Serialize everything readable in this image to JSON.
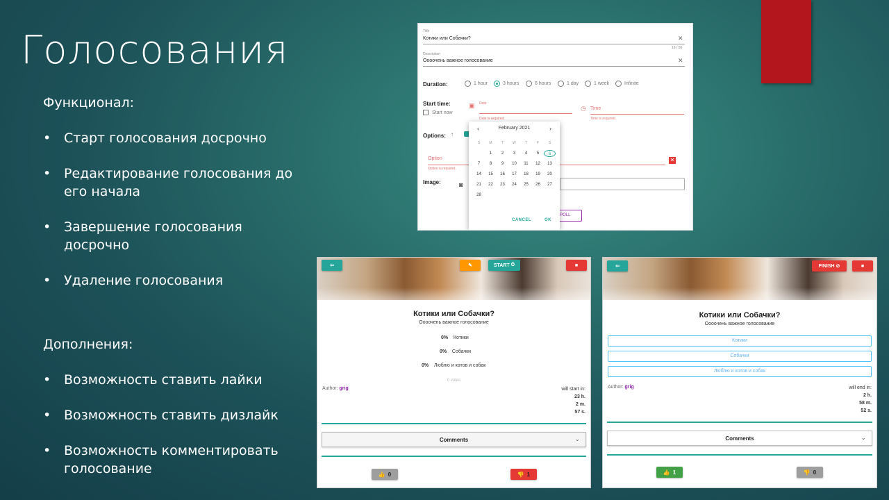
{
  "slide": {
    "title": "Голосования",
    "features_heading": "Функционал:",
    "features": [
      {
        "text": "Старт голосования досрочно"
      },
      {
        "text": "Редактирование голосования до его начала"
      },
      {
        "text": "Завершение голосования досрочно"
      },
      {
        "text": "Удаление голосования"
      }
    ],
    "extras_heading": "Дополнения:",
    "extras": [
      {
        "text": "Возможность ставить лайки"
      },
      {
        "text": "Возможность ставить дизлайк"
      },
      {
        "text": "Возможность комментировать голосование"
      }
    ],
    "accent_color": "#b3161c"
  },
  "form": {
    "title_label": "Title",
    "title_value": "Котики или Собачки?",
    "title_counter": "19 / 50",
    "description_label": "Description",
    "description_value": "Оооочень важное голосование",
    "duration_label": "Duration:",
    "durations": [
      {
        "label": "1 hour",
        "selected": false
      },
      {
        "label": "3 hours",
        "selected": true
      },
      {
        "label": "6 hours",
        "selected": false
      },
      {
        "label": "1 day",
        "selected": false
      },
      {
        "label": "1 week",
        "selected": false
      },
      {
        "label": "Infinite",
        "selected": false
      }
    ],
    "start_time_label": "Start time:",
    "start_now_label": "Start now",
    "date_placeholder": "Date",
    "date_error": "Date is required.",
    "time_placeholder": "Time",
    "time_error": "Time is required.",
    "options_label": "Options:",
    "option_placeholder": "Option",
    "option_error": "Option is required.",
    "image_label": "Image:",
    "submit_label": "NEW POLL",
    "calendar": {
      "month": "February 2021",
      "weekdays": [
        "S",
        "M",
        "T",
        "W",
        "T",
        "F",
        "S"
      ],
      "days": [
        [
          "",
          "1",
          "2",
          "3",
          "4",
          "5",
          "6"
        ],
        [
          "7",
          "8",
          "9",
          "10",
          "11",
          "12",
          "13"
        ],
        [
          "14",
          "15",
          "16",
          "17",
          "18",
          "19",
          "20"
        ],
        [
          "21",
          "22",
          "23",
          "24",
          "25",
          "26",
          "27"
        ],
        [
          "28",
          "",
          "",
          "",
          "",
          "",
          ""
        ]
      ],
      "today": "6",
      "cancel": "CANCEL",
      "ok": "OK"
    }
  },
  "card_left": {
    "start_label": "START",
    "title": "Котики или Собачки?",
    "description": "Оооочень важное голосование",
    "results": [
      {
        "percent": "0%",
        "label": "Котики"
      },
      {
        "percent": "0%",
        "label": "Собачки"
      },
      {
        "percent": "0%",
        "label": "Люблю и котов и собак"
      }
    ],
    "votes": "0 votes",
    "author_label": "Author:",
    "author": "grig",
    "timer_label": "will start in:",
    "timer": [
      "23 h.",
      "2 m.",
      "57 s."
    ],
    "comments_label": "Comments",
    "likes": "0",
    "dislikes": "1"
  },
  "card_right": {
    "finish_label": "FINISH",
    "title": "Котики или Собачки?",
    "description": "Оооочень важное голосование",
    "options": [
      "Котики",
      "Собачки",
      "Люблю и котов и собак"
    ],
    "author_label": "Author:",
    "author": "grig",
    "timer_label": "will end in:",
    "timer": [
      "2 h.",
      "58 m.",
      "52 s."
    ],
    "comments_label": "Comments",
    "likes": "1",
    "dislikes": "0"
  }
}
